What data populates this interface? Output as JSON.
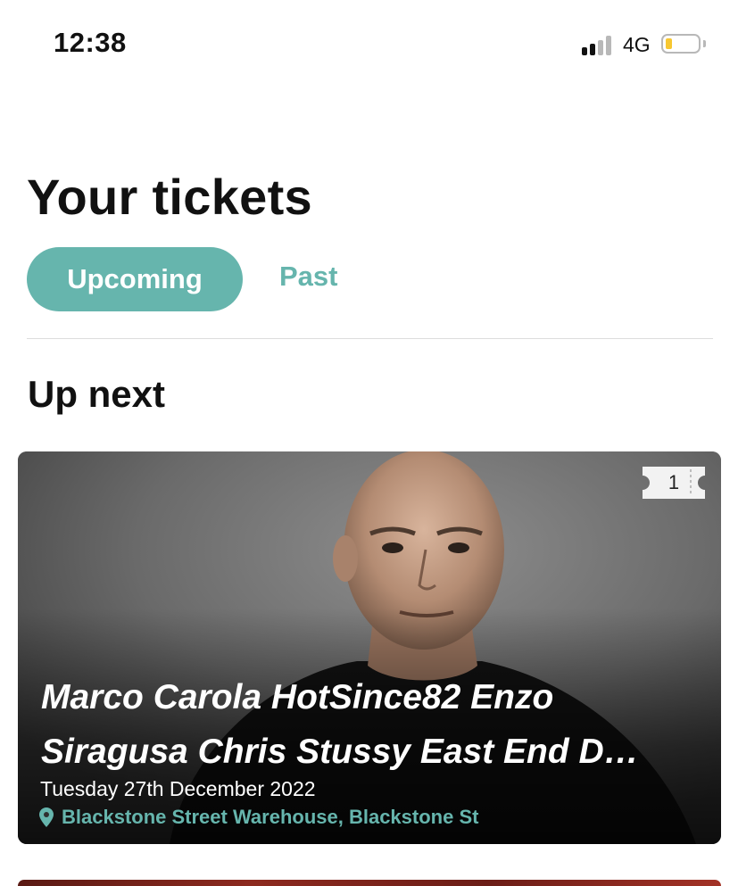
{
  "status_bar": {
    "time": "12:38",
    "network": "4G",
    "battery_level": 0.2,
    "signal_bars_active": 2,
    "signal_bars_total": 4
  },
  "page": {
    "title": "Your tickets"
  },
  "tabs": {
    "upcoming_label": "Upcoming",
    "past_label": "Past",
    "selected": "Upcoming"
  },
  "section": {
    "title": "Up next"
  },
  "event": {
    "title": "Marco Carola HotSince82 Enzo Siragusa Chris Stussy East End D…",
    "date": "Tuesday 27th December 2022",
    "venue": "Blackstone Street Warehouse, Blackstone St",
    "ticket_count": "1"
  },
  "colors": {
    "accent": "#66b5ad",
    "battery": "#f7c731",
    "text_dark": "#111111"
  },
  "icons": {
    "ticket": "ticket-icon",
    "location": "location-pin-icon",
    "signal": "cellular-signal-icon",
    "battery": "battery-icon"
  }
}
